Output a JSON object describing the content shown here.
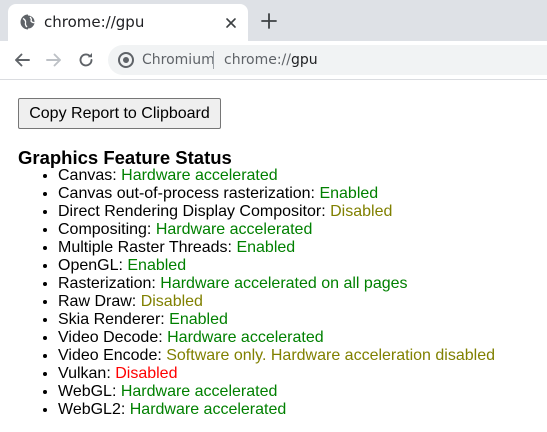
{
  "browser": {
    "tab": {
      "title": "chrome://gpu"
    },
    "omnibox": {
      "origin_label": "Chromium",
      "url_scheme": "chrome://",
      "url_host": "gpu"
    }
  },
  "page": {
    "copy_button_label": "Copy Report to Clipboard",
    "heading": "Graphics Feature Status",
    "features": [
      {
        "name": "Canvas: ",
        "status": "Hardware accelerated",
        "color": "#008000"
      },
      {
        "name": "Canvas out-of-process rasterization: ",
        "status": "Enabled",
        "color": "#008000"
      },
      {
        "name": "Direct Rendering Display Compositor: ",
        "status": "Disabled",
        "color": "#808000"
      },
      {
        "name": "Compositing: ",
        "status": "Hardware accelerated",
        "color": "#008000"
      },
      {
        "name": "Multiple Raster Threads: ",
        "status": "Enabled",
        "color": "#008000"
      },
      {
        "name": "OpenGL: ",
        "status": "Enabled",
        "color": "#008000"
      },
      {
        "name": "Rasterization: ",
        "status": "Hardware accelerated on all pages",
        "color": "#008000"
      },
      {
        "name": "Raw Draw: ",
        "status": "Disabled",
        "color": "#808000"
      },
      {
        "name": "Skia Renderer: ",
        "status": "Enabled",
        "color": "#008000"
      },
      {
        "name": "Video Decode: ",
        "status": "Hardware accelerated",
        "color": "#008000"
      },
      {
        "name": "Video Encode: ",
        "status": "Software only. Hardware acceleration disabled",
        "color": "#808000"
      },
      {
        "name": "Vulkan: ",
        "status": "Disabled",
        "color": "#ff0000"
      },
      {
        "name": "WebGL: ",
        "status": "Hardware accelerated",
        "color": "#008000"
      },
      {
        "name": "WebGL2: ",
        "status": "Hardware accelerated",
        "color": "#008000"
      }
    ]
  },
  "icons": {
    "tab_favicon": "globe-icon",
    "tab_close": "close-icon",
    "new_tab": "plus-icon",
    "back": "back-arrow-icon",
    "forward": "forward-arrow-icon",
    "reload": "reload-icon",
    "omnibox_info": "chromium-info-icon"
  }
}
